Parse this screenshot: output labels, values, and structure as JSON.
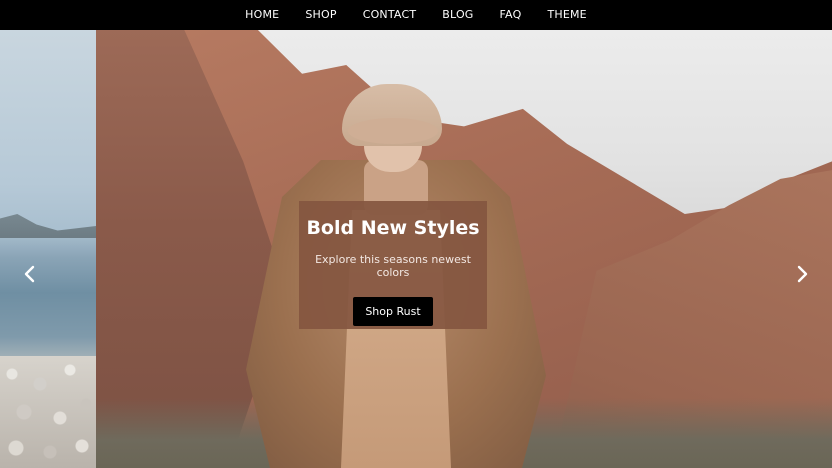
{
  "nav": {
    "items": [
      "HOME",
      "SHOP",
      "CONTACT",
      "BLOG",
      "FAQ",
      "THEME"
    ]
  },
  "hero": {
    "title": "Bold New Styles",
    "subtitle": "Explore this seasons newest colors",
    "cta_label": "Shop Rust"
  },
  "icons": {
    "prev": "chevron-left-icon",
    "next": "chevron-right-icon"
  },
  "colors": {
    "nav_bg": "#000000",
    "card_bg": "#845640",
    "cta_bg": "#000000"
  }
}
